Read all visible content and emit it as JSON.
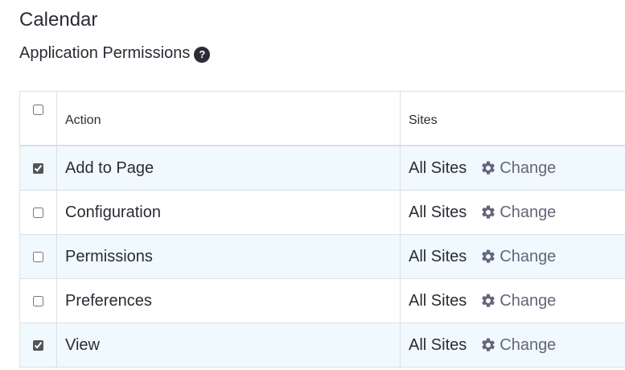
{
  "title": "Calendar",
  "subtitle": "Application Permissions",
  "help_icon_glyph": "?",
  "table": {
    "headers": {
      "action": "Action",
      "sites": "Sites"
    },
    "select_all_checked": false,
    "rows": [
      {
        "action": "Add to Page",
        "sites": "All Sites",
        "change": "Change",
        "checked": true
      },
      {
        "action": "Configuration",
        "sites": "All Sites",
        "change": "Change",
        "checked": false
      },
      {
        "action": "Permissions",
        "sites": "All Sites",
        "change": "Change",
        "checked": false
      },
      {
        "action": "Preferences",
        "sites": "All Sites",
        "change": "Change",
        "checked": false
      },
      {
        "action": "View",
        "sites": "All Sites",
        "change": "Change",
        "checked": true
      }
    ]
  },
  "icons": {
    "help": "question-circle-icon",
    "change": "gear-icon"
  },
  "colors": {
    "text": "#2b2b35",
    "link": "#65657b",
    "row_shade": "#f0f9fd",
    "border": "#dedee5"
  }
}
